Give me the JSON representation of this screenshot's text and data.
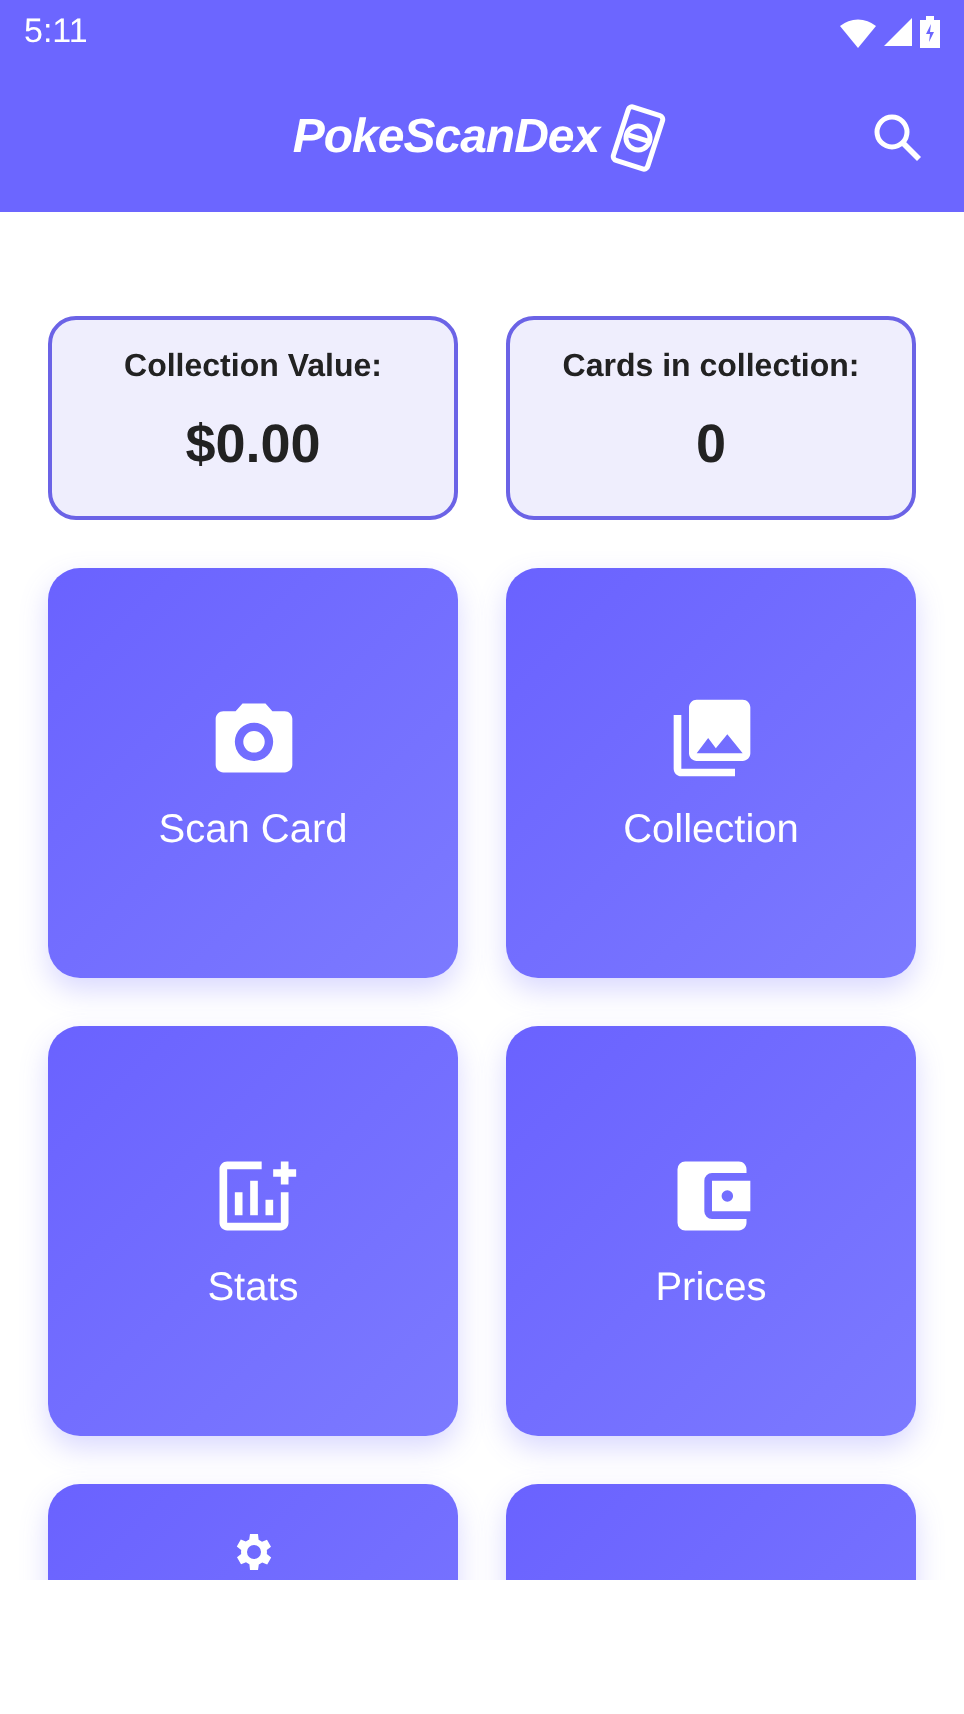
{
  "status_bar": {
    "time": "5:11"
  },
  "app_bar": {
    "title": "PokeScanDex"
  },
  "stats": [
    {
      "label": "Collection Value:",
      "value": "$0.00"
    },
    {
      "label": "Cards in collection:",
      "value": "0"
    }
  ],
  "tiles": [
    {
      "kind": "camera",
      "label": "Scan Card"
    },
    {
      "kind": "photos",
      "label": "Collection"
    },
    {
      "kind": "stats",
      "label": "Stats"
    },
    {
      "kind": "wallet",
      "label": "Prices"
    },
    {
      "kind": "gear"
    },
    {
      "kind": "blank"
    }
  ]
}
